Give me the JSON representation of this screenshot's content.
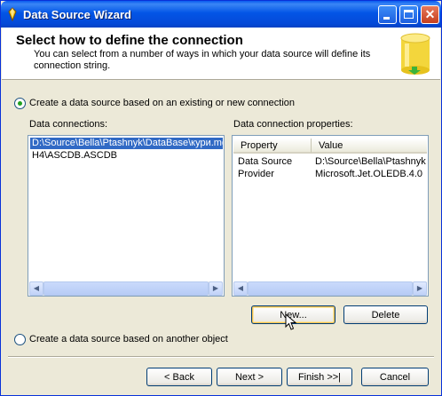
{
  "window": {
    "title": "Data Source Wizard",
    "controls": {
      "minimize": "_",
      "maximize": "□",
      "close": "✕"
    }
  },
  "header": {
    "title": "Select how to define the connection",
    "description": "You can select from a number of ways in which your data source will define its connection string."
  },
  "options": {
    "existing_connection": {
      "label": "Create a data source based on an existing or new connection",
      "selected": true
    },
    "another_object": {
      "label": "Create a data source based on another object",
      "selected": false
    }
  },
  "connections": {
    "label": "Data connections:",
    "items": [
      {
        "text": "D:\\Source\\Bella\\Ptashnyk\\DataBase\\кури.md",
        "selected": true
      },
      {
        "text": "H4\\ASCDB.ASCDB",
        "selected": false
      }
    ]
  },
  "properties": {
    "label": "Data connection properties:",
    "columns": [
      "Property",
      "Value"
    ],
    "rows": [
      {
        "property": "Data Source",
        "value": "D:\\Source\\Bella\\Ptashnyk"
      },
      {
        "property": "Provider",
        "value": "Microsoft.Jet.OLEDB.4.0"
      }
    ]
  },
  "actions": {
    "new": "New...",
    "delete": "Delete"
  },
  "footer": {
    "back": "< Back",
    "next": "Next >",
    "finish": "Finish >>|",
    "cancel": "Cancel"
  },
  "colors": {
    "titlebar": "#0355E6",
    "selection": "#316AC5",
    "radio_dot": "#21A121"
  }
}
